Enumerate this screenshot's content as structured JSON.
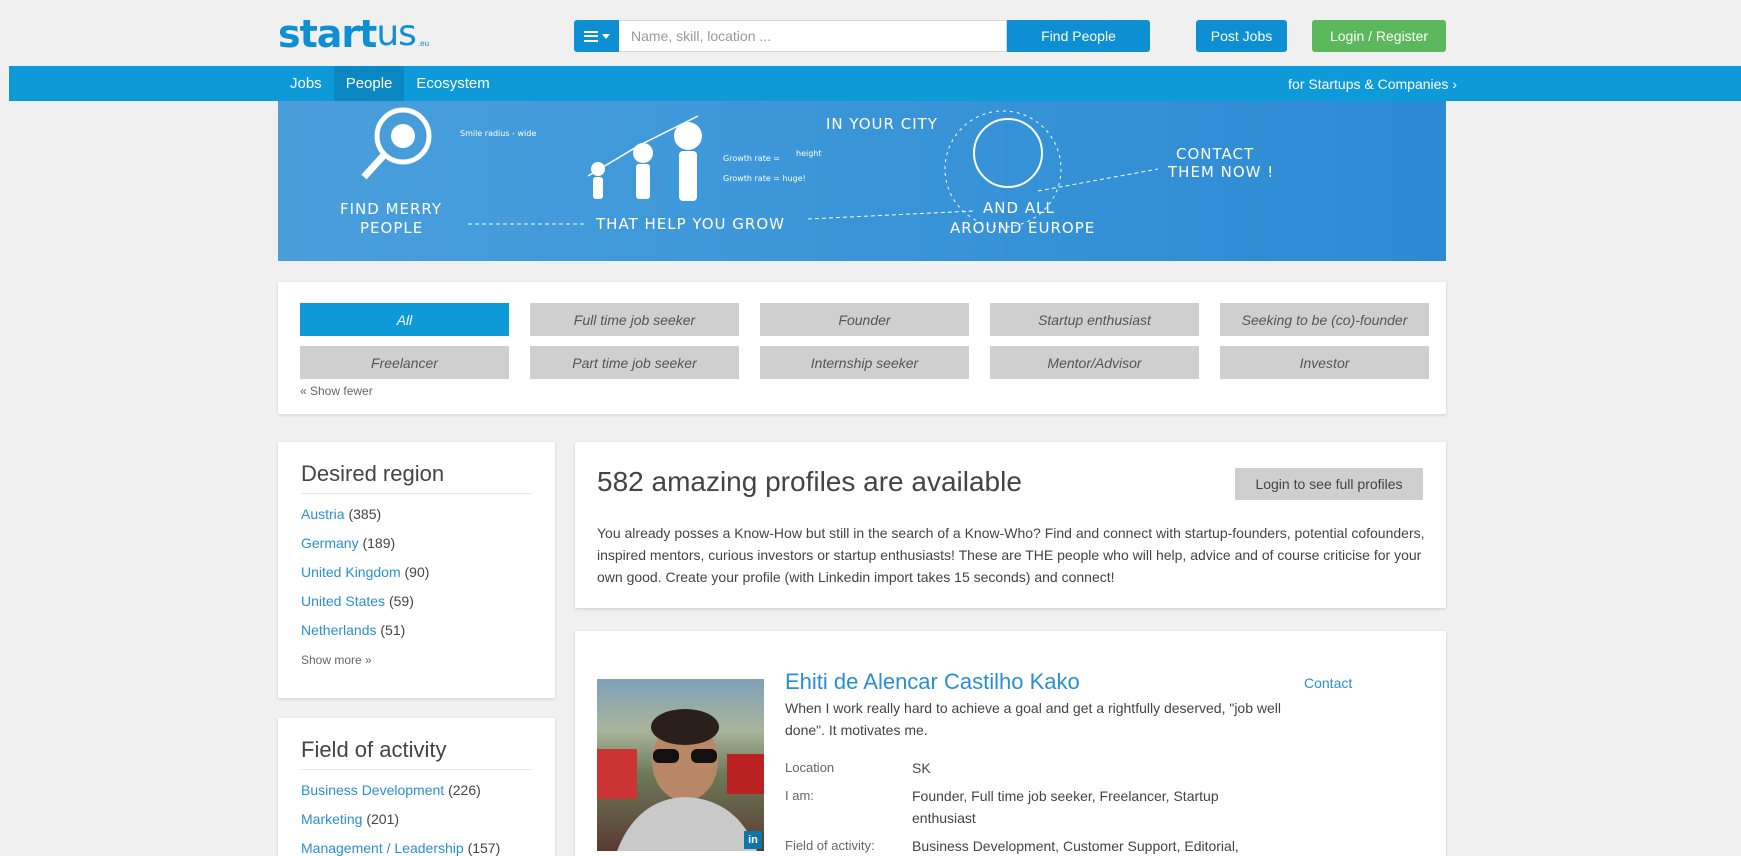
{
  "header": {
    "logo_bold": "start",
    "logo_thin": "us",
    "logo_tld": ".eu",
    "search_placeholder": "Name, skill, location ...",
    "find_button": "Find People",
    "post_jobs": "Post Jobs",
    "login_register": "Login / Register"
  },
  "nav": {
    "items": [
      {
        "label": "Jobs",
        "active": false
      },
      {
        "label": "People",
        "active": true
      },
      {
        "label": "Ecosystem",
        "active": false
      }
    ],
    "right_link": "for Startups & Companies ›"
  },
  "banner": {
    "find_merry": "FIND MERRY",
    "people": "PEOPLE",
    "smile_radius": "Smile radius - wide",
    "that_help": "THAT HELP YOU GROW",
    "growth1": "Growth rate =",
    "height_word": "height",
    "growth2": "Growth rate = huge!",
    "in_your_city": "IN YOUR CITY",
    "and_all": "AND ALL",
    "around_europe": "AROUND EUROPE",
    "contact": "CONTACT",
    "them_now": "THEM NOW !"
  },
  "filters": {
    "chips": [
      {
        "label": "All",
        "active": true
      },
      {
        "label": "Full time job seeker",
        "active": false
      },
      {
        "label": "Founder",
        "active": false
      },
      {
        "label": "Startup enthusiast",
        "active": false
      },
      {
        "label": "Seeking to be (co)-founder",
        "active": false
      },
      {
        "label": "Freelancer",
        "active": false
      },
      {
        "label": "Part time job seeker",
        "active": false
      },
      {
        "label": "Internship seeker",
        "active": false
      },
      {
        "label": "Mentor/Advisor",
        "active": false
      },
      {
        "label": "Investor",
        "active": false
      }
    ],
    "show_fewer": "« Show fewer"
  },
  "region": {
    "title": "Desired region",
    "items": [
      {
        "name": "Austria",
        "count": "(385)"
      },
      {
        "name": "Germany",
        "count": "(189)"
      },
      {
        "name": "United Kingdom",
        "count": "(90)"
      },
      {
        "name": "United States",
        "count": "(59)"
      },
      {
        "name": "Netherlands",
        "count": "(51)"
      }
    ],
    "show_more": "Show more »"
  },
  "activity": {
    "title": "Field of activity",
    "items": [
      {
        "name": "Business Development",
        "count": "(226)"
      },
      {
        "name": "Marketing",
        "count": "(201)"
      },
      {
        "name": "Management / Leadership",
        "count": "(157)"
      }
    ]
  },
  "main": {
    "title": "582 amazing profiles are available",
    "login_full": "Login to see full profiles",
    "description": "You already posses a Know-How but still in the search of a Know-Who? Find and connect with startup-founders, potential cofounders, inspired mentors, curious investors or startup enthusiasts! These are THE people who will help, advice and of course criticise for your own good. Create your profile (with Linkedin import takes 15 seconds) and connect!"
  },
  "profile": {
    "name": "Ehiti de Alencar Castilho Kako",
    "contact": "Contact",
    "quote": "When I work really hard to achieve a goal and get a rightfully deserved, \"job well done\". It motivates me.",
    "linkedin_badge": "in",
    "fields": [
      {
        "label": "Location",
        "value": "SK"
      },
      {
        "label": "I am:",
        "value": "Founder, Full time job seeker, Freelancer, Startup enthusiast"
      },
      {
        "label": "Field of activity:",
        "value": "Business Development, Customer Support, Editorial,"
      }
    ]
  },
  "colors": {
    "brand_blue": "#0e9ad9",
    "green": "#5cb85c",
    "link": "#2a8fd0"
  }
}
